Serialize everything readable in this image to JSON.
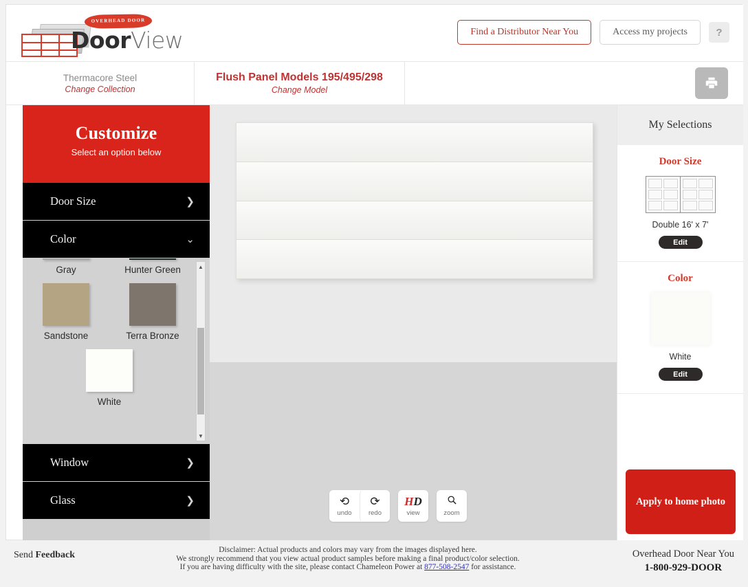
{
  "header": {
    "logo": {
      "banner_text": "OVERHEAD DOOR",
      "brand_bold": "Door",
      "brand_light": "View"
    },
    "find_distributor_label": "Find a Distributor Near You",
    "access_projects_label": "Access my projects",
    "help_label": "?"
  },
  "subbar": {
    "collection_name": "Thermacore Steel",
    "collection_link": "Change Collection",
    "model_name": "Flush Panel Models 195/495/298",
    "model_link": "Change Model",
    "print_icon": "printer-icon"
  },
  "sidebar": {
    "title": "Customize",
    "subtitle": "Select an option below",
    "items": [
      {
        "label": "Door Size",
        "chevron": "❯",
        "expanded": false
      },
      {
        "label": "Color",
        "chevron": "⌄",
        "expanded": true
      },
      {
        "label": "Window",
        "chevron": "❯",
        "expanded": false
      },
      {
        "label": "Glass",
        "chevron": "❯",
        "expanded": false
      }
    ],
    "colors": [
      {
        "name": "Gray",
        "hex": "#a8a8a6"
      },
      {
        "name": "Hunter Green",
        "hex": "#182a21"
      },
      {
        "name": "Sandstone",
        "hex": "#b5a484"
      },
      {
        "name": "Terra Bronze",
        "hex": "#7e766c"
      },
      {
        "name": "White",
        "hex": "#fdfdf9"
      }
    ]
  },
  "canvas": {
    "door_panel_count": 4,
    "door_color": "#f7f7f5",
    "tools": [
      {
        "label": "undo",
        "icon": "undo-arrow-icon",
        "glyph": "↶"
      },
      {
        "label": "redo",
        "icon": "redo-arrow-icon",
        "glyph": "↷"
      },
      {
        "label": "view",
        "icon": "hd-icon",
        "glyph": "HD"
      },
      {
        "label": "zoom",
        "icon": "magnifier-icon",
        "glyph": "⌕"
      }
    ]
  },
  "selections": {
    "header": "My Selections",
    "door_size": {
      "title": "Door Size",
      "value": "Double 16' x 7'",
      "edit_label": "Edit"
    },
    "color": {
      "title": "Color",
      "value": "White",
      "hex": "#fbfbf8",
      "edit_label": "Edit"
    },
    "apply_label": "Apply to home photo"
  },
  "footer": {
    "feedback_prefix": "Send ",
    "feedback_bold": "Feedback",
    "disclaimer_line1": "Disclaimer: Actual products and colors may vary from the images displayed here.",
    "disclaimer_line2": "We strongly recommend that you view actual product samples before making a final product/color selection.",
    "disclaimer_line3_pre": "If you are having difficulty with the site, please contact Chameleon Power at ",
    "disclaimer_phone": "877-508-2547",
    "disclaimer_line3_post": " for assistance.",
    "near_you": "Overhead Door Near You",
    "phone": "1-800-929-DOOR"
  },
  "theme": {
    "brand_red": "#d9241c",
    "accent_red": "#bf3232",
    "menu_black": "#000000"
  }
}
